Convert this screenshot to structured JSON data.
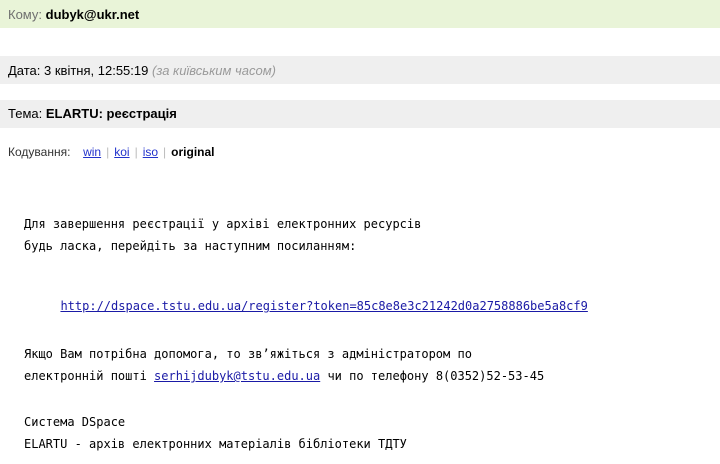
{
  "header": {
    "to_label": "Кому:",
    "to_value": "dubyk@ukr.net",
    "date_label": "Дата:",
    "date_value": "3 квітня, 12:55:19",
    "date_note": "(за київським часом)",
    "subject_label": "Тема:",
    "subject_value": "ELARTU: реєстрація"
  },
  "encoding": {
    "label": "Кодування:",
    "options": [
      "win",
      "koi",
      "iso",
      "original"
    ],
    "selected": "original"
  },
  "body": {
    "line1": "Для завершення реєстрації у архіві електронних ресурсів",
    "line2": "будь ласка, перейдіть за наступним посиланням:",
    "register_link": "http://dspace.tstu.edu.ua/register?token=85c8e8e3c21242d0a2758886be5a8cf9",
    "help_line1": "Якщо Вам потрібна допомога, то зв’яжіться з адміністратором по",
    "help_line2_prefix": "електронній пошті ",
    "help_email": "serhijdubyk@tstu.edu.ua",
    "help_line2_suffix": " чи по телефону 8(0352)52-53-45",
    "sign_line1": "Система DSpace",
    "sign_line2": "ELARTU - архів електронних матеріалів бібліотеки ТДТУ"
  },
  "colors": {
    "header_green": "#e9f4d8",
    "header_gray": "#efefef",
    "link_blue": "#1a1aa6"
  }
}
